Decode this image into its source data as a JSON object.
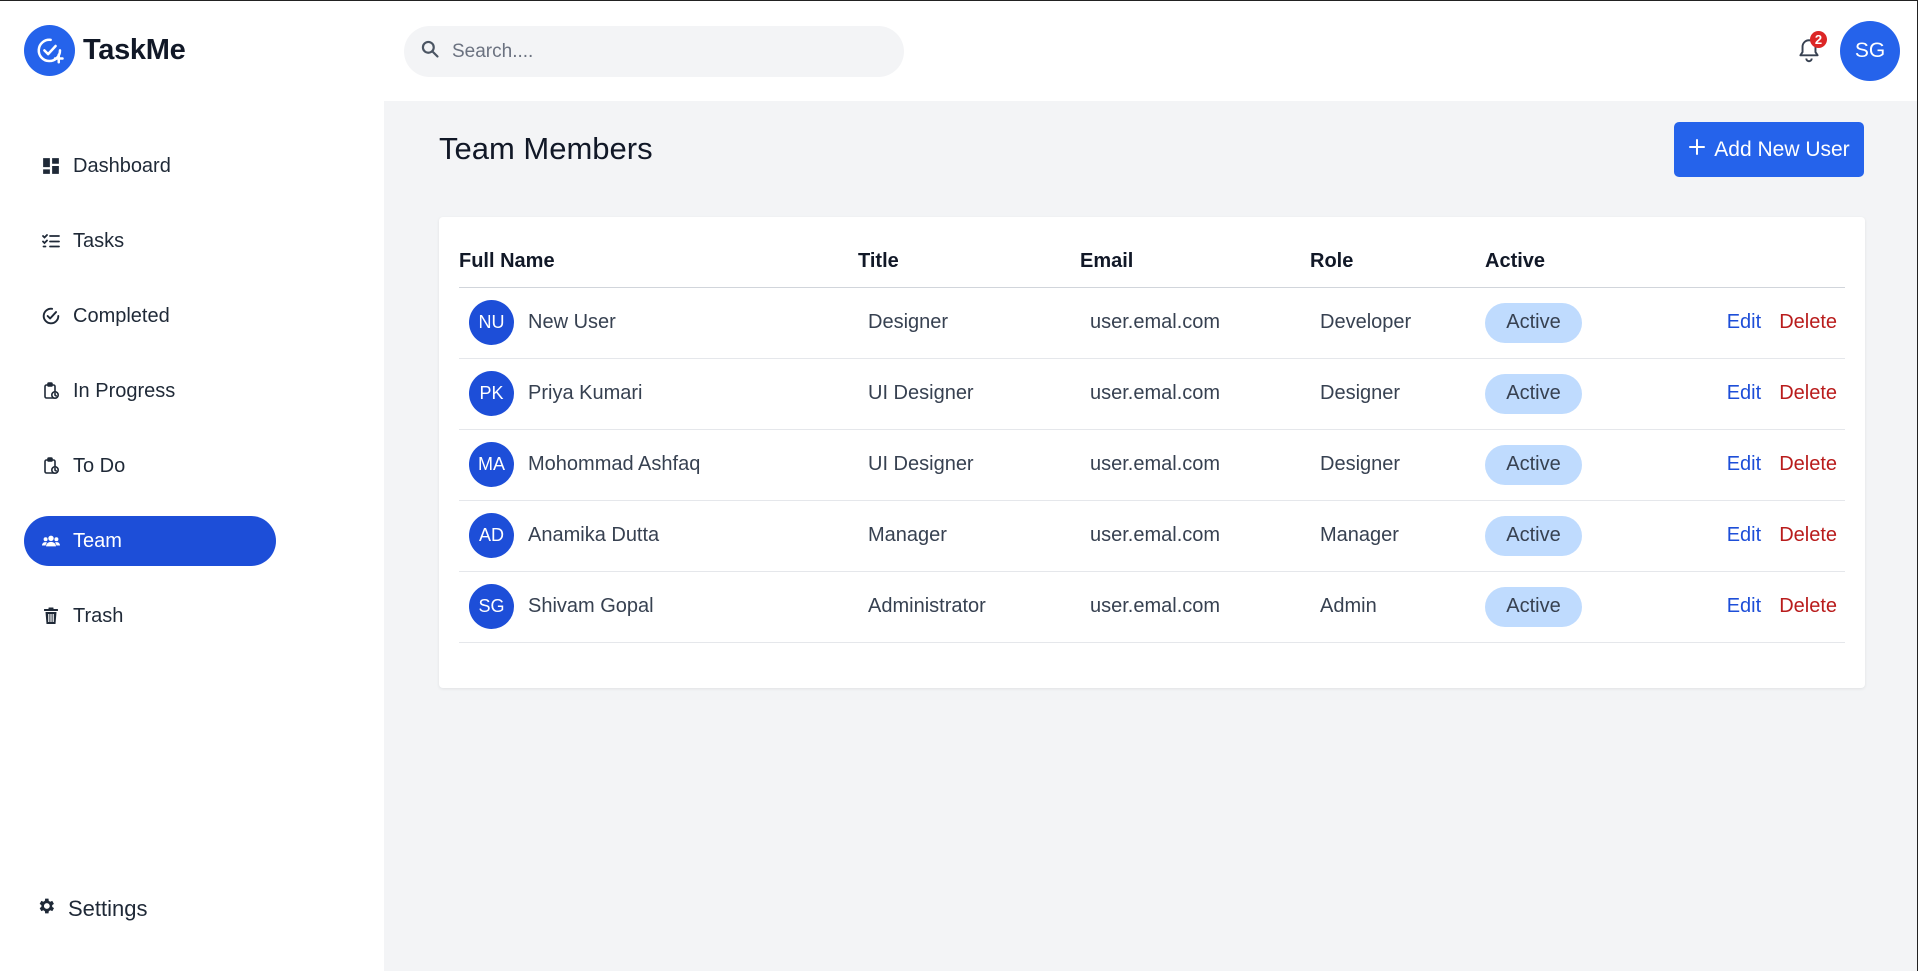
{
  "app": {
    "name": "TaskMe"
  },
  "sidebar": {
    "items": [
      {
        "label": "Dashboard",
        "icon": "dashboard-icon"
      },
      {
        "label": "Tasks",
        "icon": "tasks-icon"
      },
      {
        "label": "Completed",
        "icon": "completed-icon"
      },
      {
        "label": "In Progress",
        "icon": "in-progress-icon"
      },
      {
        "label": "To Do",
        "icon": "todo-icon"
      },
      {
        "label": "Team",
        "icon": "team-icon",
        "active": true
      },
      {
        "label": "Trash",
        "icon": "trash-icon"
      }
    ],
    "settings_label": "Settings"
  },
  "topbar": {
    "search_placeholder": "Search....",
    "notification_count": "2",
    "user_initials": "SG"
  },
  "main": {
    "title": "Team Members",
    "add_button_label": "Add New User",
    "table": {
      "headers": [
        "Full Name",
        "Title",
        "Email",
        "Role",
        "Active"
      ],
      "rows": [
        {
          "initials": "NU",
          "name": "New User",
          "title": "Designer",
          "email": "user.emal.com",
          "role": "Developer",
          "status": "Active"
        },
        {
          "initials": "PK",
          "name": "Priya Kumari",
          "title": "UI Designer",
          "email": "user.emal.com",
          "role": "Designer",
          "status": "Active"
        },
        {
          "initials": "MA",
          "name": "Mohommad Ashfaq",
          "title": "UI Designer",
          "email": "user.emal.com",
          "role": "Designer",
          "status": "Active"
        },
        {
          "initials": "AD",
          "name": "Anamika Dutta",
          "title": "Manager",
          "email": "user.emal.com",
          "role": "Manager",
          "status": "Active"
        },
        {
          "initials": "SG",
          "name": "Shivam Gopal",
          "title": "Administrator",
          "email": "user.emal.com",
          "role": "Admin",
          "status": "Active"
        }
      ],
      "edit_label": "Edit",
      "delete_label": "Delete"
    }
  },
  "colors": {
    "primary": "#2563eb",
    "active_nav": "#1d4ed8",
    "badge_bg": "#bfdbfe",
    "delete": "#b91c1c",
    "notification": "#dc2626",
    "content_bg": "#f3f4f6"
  }
}
